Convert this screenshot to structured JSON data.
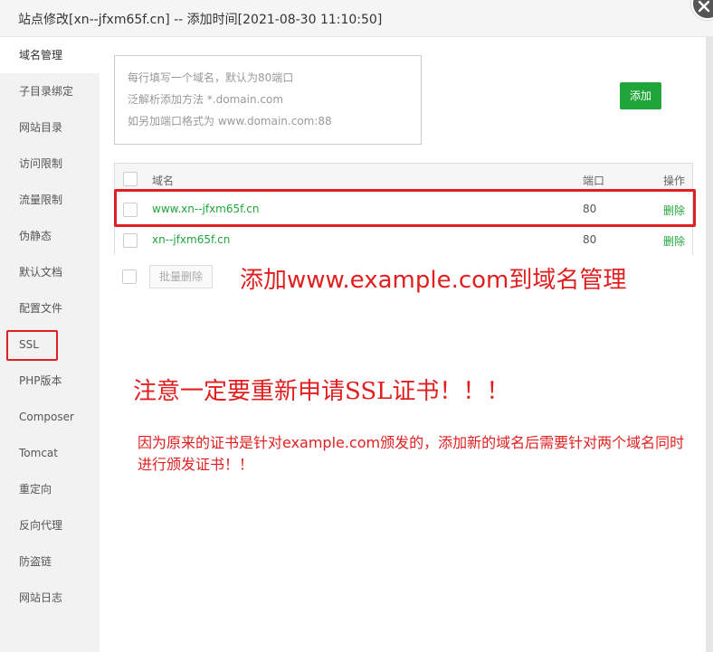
{
  "dialog": {
    "title": "站点修改[xn--jfxm65f.cn] -- 添加时间[2021-08-30 11:10:50]"
  },
  "sidebar": {
    "items": [
      {
        "label": "域名管理",
        "active": true
      },
      {
        "label": "子目录绑定"
      },
      {
        "label": "网站目录"
      },
      {
        "label": "访问限制"
      },
      {
        "label": "流量限制"
      },
      {
        "label": "伪静态"
      },
      {
        "label": "默认文档"
      },
      {
        "label": "配置文件"
      },
      {
        "label": "SSL"
      },
      {
        "label": "PHP版本"
      },
      {
        "label": "Composer"
      },
      {
        "label": "Tomcat"
      },
      {
        "label": "重定向"
      },
      {
        "label": "反向代理"
      },
      {
        "label": "防盗链"
      },
      {
        "label": "网站日志"
      }
    ]
  },
  "domain_input": {
    "placeholder_lines": [
      "每行填写一个域名，默认为80端口",
      "泛解析添加方法 *.domain.com",
      "如另加端口格式为 www.domain.com:88"
    ],
    "add_label": "添加"
  },
  "table": {
    "headers": {
      "domain": "域名",
      "port": "端口",
      "action": "操作"
    },
    "rows": [
      {
        "domain": "www.xn--jfxm65f.cn",
        "port": "80",
        "action": "删除"
      },
      {
        "domain": "xn--jfxm65f.cn",
        "port": "80",
        "action": "删除"
      }
    ]
  },
  "batch_delete_label": "批量删除",
  "annotations": {
    "line1": "添加www.example.com到域名管理",
    "line2": "注意一定要重新申请SSL证书！！！",
    "line3": "因为原来的证书是针对example.com颁发的，添加新的域名后需要针对两个域名同时进行颁发证书！！"
  },
  "colors": {
    "accent_green": "#20a53a",
    "annotation_red": "#e02020"
  }
}
